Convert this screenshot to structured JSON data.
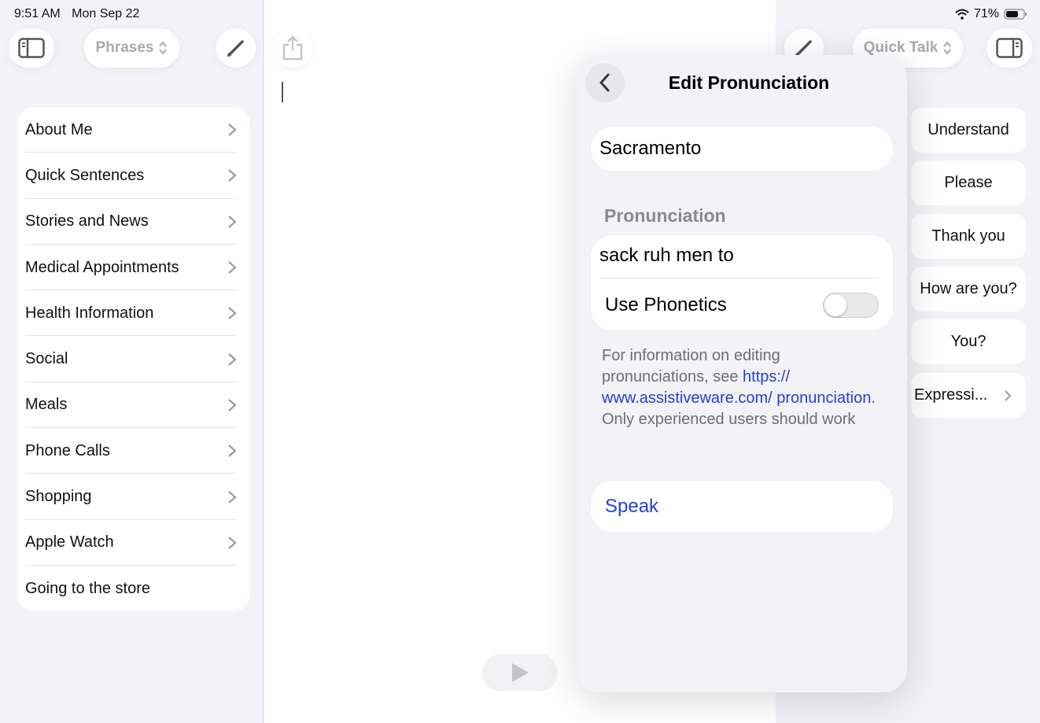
{
  "status": {
    "time": "9:51 AM",
    "date": "Mon Sep 22",
    "battery": "71%"
  },
  "left": {
    "category_picker": "Phrases",
    "categories": [
      "About Me",
      "Quick Sentences",
      "Stories and News",
      "Medical Appointments",
      "Health Information",
      "Social",
      "Meals",
      "Phone Calls",
      "Shopping",
      "Apple Watch",
      "Going to the store"
    ]
  },
  "right": {
    "mode_picker": "Quick Talk",
    "phrases": [
      "Understand",
      "Please",
      "Thank you",
      "How are you?",
      "You?"
    ],
    "folder": "Expressi..."
  },
  "popover": {
    "title": "Edit Pronunciation",
    "word": "Sacramento",
    "section_label": "Pronunciation",
    "pronunciation": "sack ruh men to",
    "phonetics_label": "Use Phonetics",
    "phonetics_on": false,
    "info_text_1": "For information on editing pronunciations, see ",
    "info_link": "https:// www.assistiveware.com/ pronunciation",
    "info_text_2": ".",
    "info_text_3": "Only experienced users should work",
    "speak_label": "Speak"
  },
  "colors": {
    "accent": "#2740d1",
    "background": "#f2f2f7"
  }
}
